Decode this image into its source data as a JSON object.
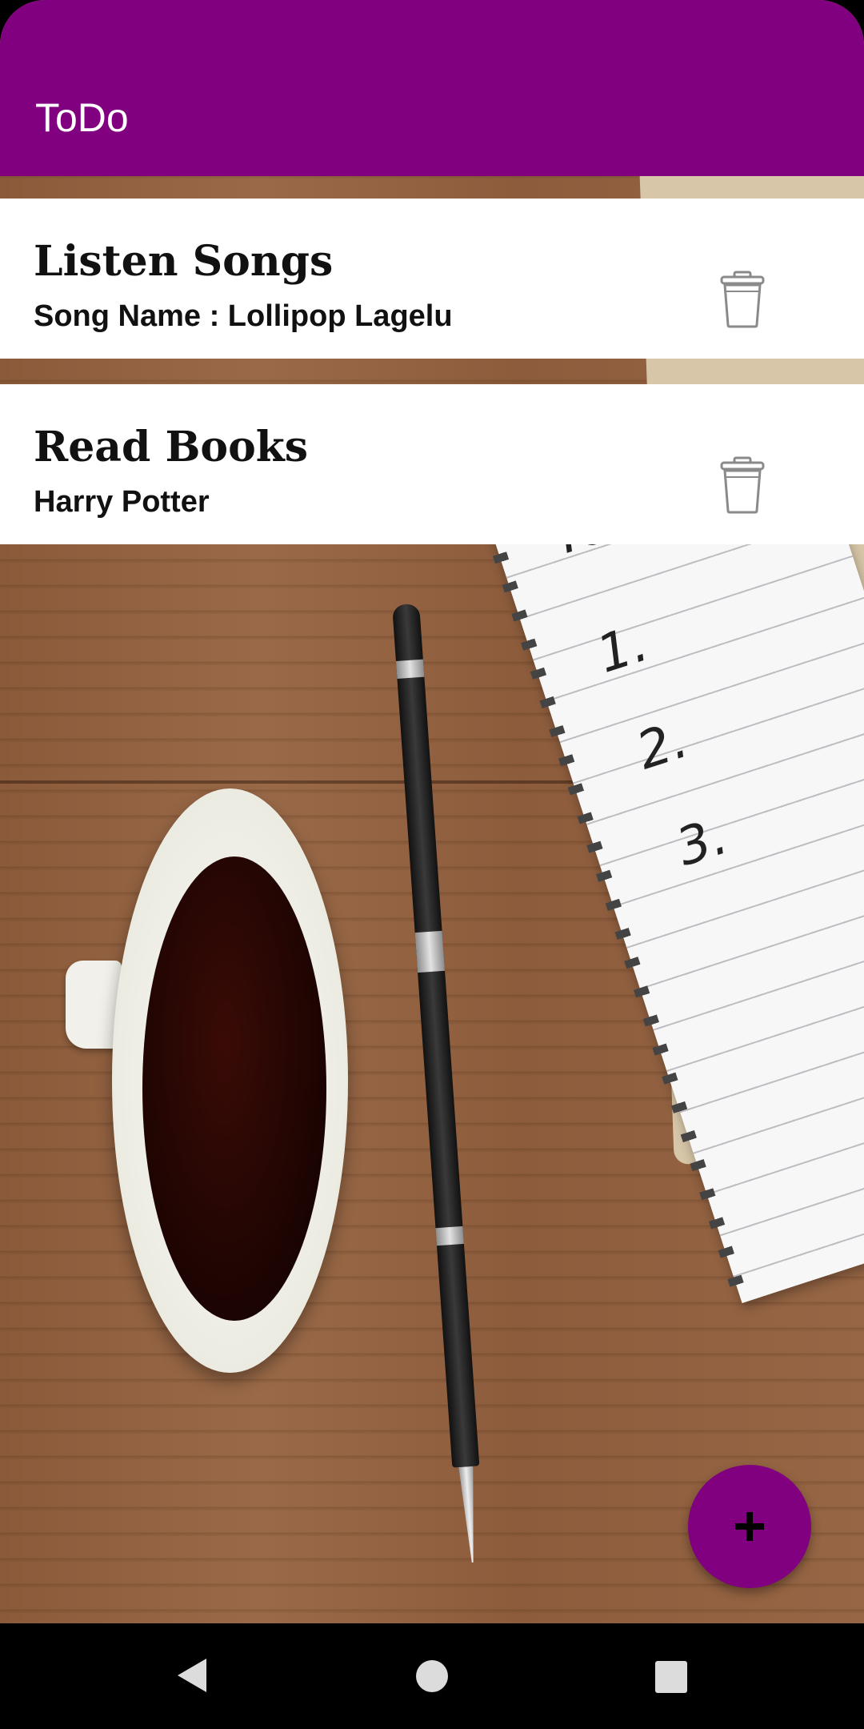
{
  "app_bar": {
    "title": "ToDo",
    "color": "#800080"
  },
  "tasks": [
    {
      "title": "Listen Songs",
      "subtitle": "Song Name : Lollipop Lagelu",
      "action_icon": "trash-icon"
    },
    {
      "title": "Read Books",
      "subtitle": "Harry Potter",
      "action_icon": "trash-icon"
    }
  ],
  "background_notebook": {
    "heading": "To Do",
    "items": [
      "1.",
      "2.",
      "3."
    ]
  },
  "fab": {
    "icon": "plus-icon",
    "color": "#800080"
  },
  "nav_bar": {
    "buttons": [
      "back-icon",
      "home-icon",
      "recents-icon"
    ]
  }
}
